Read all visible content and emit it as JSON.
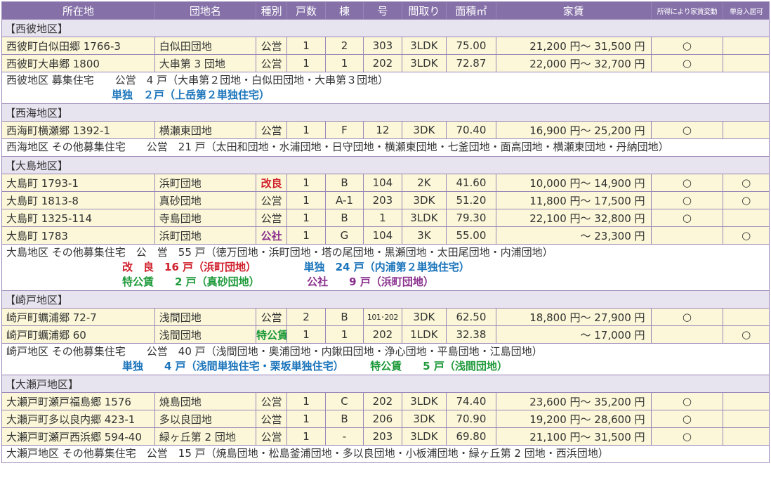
{
  "headers": [
    "所在地",
    "団地名",
    "種別",
    "戸数",
    "棟",
    "号",
    "間取り",
    "面積㎡",
    "家賃",
    "所得により家賃変動",
    "単身入居可"
  ],
  "sections": [
    {
      "title": "【西彼地区】",
      "rows": [
        {
          "addr": "西彼町白似田郷 1766-3",
          "name": "白似田団地",
          "type": "公営",
          "typeClass": "",
          "count": "1",
          "bldg": "2",
          "num": "303",
          "layout": "3LDK",
          "area": "75.00",
          "rent": "21,200 円〜 31,500 円",
          "income": "○",
          "single": ""
        },
        {
          "addr": "西彼町大串郷 1800",
          "name": "大串第 3 団地",
          "type": "公営",
          "typeClass": "",
          "count": "1",
          "bldg": "1",
          "num": "202",
          "layout": "3LDK",
          "area": "72.87",
          "rent": "22,000 円〜 32,700 円",
          "income": "○",
          "single": ""
        }
      ],
      "summary": [
        [
          {
            "t": "西彼地区 募集住宅　　公営　4 戸（大串第２団地・白似田団地・大串第３団地）",
            "c": "black"
          }
        ],
        [
          {
            "t": "　　　　　　　　　　単独　２戸（上岳第２単独住宅）",
            "c": "blue"
          }
        ]
      ]
    },
    {
      "title": "【西海地区】",
      "rows": [
        {
          "addr": "西海町横瀬郷 1392-1",
          "name": "横瀬東団地",
          "type": "公営",
          "typeClass": "",
          "count": "1",
          "bldg": "F",
          "num": "12",
          "layout": "3DK",
          "area": "70.40",
          "rent": "16,900 円〜 25,200 円",
          "income": "○",
          "single": ""
        }
      ],
      "summary": [
        [
          {
            "t": "西海地区 その他募集住宅　　公営　21 戸（太田和団地・水浦団地・日守団地・横瀬東団地・七釜団地・面高団地・横瀬東団地・丹納団地）",
            "c": "black"
          }
        ]
      ]
    },
    {
      "title": "【大島地区】",
      "rows": [
        {
          "addr": "大島町 1793-1",
          "name": "浜町団地",
          "type": "改良",
          "typeClass": "tag-red",
          "count": "1",
          "bldg": "B",
          "num": "104",
          "layout": "2K",
          "area": "41.60",
          "rent": "10,000 円〜 14,900 円",
          "income": "○",
          "single": "○"
        },
        {
          "addr": "大島町 1813-8",
          "name": "真砂団地",
          "type": "公営",
          "typeClass": "",
          "count": "1",
          "bldg": "A-1",
          "num": "203",
          "layout": "3DK",
          "area": "51.20",
          "rent": "11,800 円〜 17,500 円",
          "income": "○",
          "single": "○"
        },
        {
          "addr": "大島町 1325-114",
          "name": "寺島団地",
          "type": "公営",
          "typeClass": "",
          "count": "1",
          "bldg": "B",
          "num": "1",
          "layout": "3LDK",
          "area": "79.30",
          "rent": "22,100 円〜 32,800 円",
          "income": "○",
          "single": ""
        },
        {
          "addr": "大島町 1783",
          "name": "浜町団地",
          "type": "公社",
          "typeClass": "tag-purple",
          "count": "1",
          "bldg": "G",
          "num": "104",
          "layout": "3K",
          "area": "55.00",
          "rent": "〜 23,300 円",
          "income": "",
          "single": "○"
        }
      ],
      "summary": [
        [
          {
            "t": "大島地区 その他募集住宅　公　営　55 戸（徳万団地・浜町団地・塔の尾団地・黒瀬団地・太田尾団地・内浦団地）",
            "c": "black"
          }
        ],
        [
          {
            "t": "　　　　　　　　　　　改　良　16 戸（浜町団地）　　　",
            "c": "red"
          },
          {
            "t": "　　単独　24 戸（内浦第２単独住宅）",
            "c": "blue"
          }
        ],
        [
          {
            "t": "　　　　　　　　　　　特公賃　　2 戸（真砂団地）　　　",
            "c": "green"
          },
          {
            "t": "　　公社　　9 戸（浜町団地）",
            "c": "purple"
          }
        ]
      ]
    },
    {
      "title": "【崎戸地区】",
      "rows": [
        {
          "addr": "崎戸町蠣浦郷 72-7",
          "name": "浅間団地",
          "type": "公営",
          "typeClass": "",
          "count": "2",
          "bldg": "B",
          "num": "101･202",
          "layout": "3DK",
          "area": "62.50",
          "rent": "18,800 円〜 27,900 円",
          "income": "○",
          "single": "",
          "numSmall": true
        },
        {
          "addr": "崎戸町蠣浦郷 60",
          "name": "浅間団地",
          "type": "特公賃",
          "typeClass": "tag-green",
          "count": "1",
          "bldg": "1",
          "num": "202",
          "layout": "1LDK",
          "area": "32.38",
          "rent": "〜 17,000 円",
          "income": "",
          "single": "○"
        }
      ],
      "summary": [
        [
          {
            "t": "崎戸地区 その他募集住宅　　公営　40 戸（浅間団地・奥浦団地・内鍬田団地・浄心団地・平島団地・江島団地）",
            "c": "black"
          }
        ],
        [
          {
            "t": "　　　　　　　　　　　単独　　4 戸（浅間単独住宅・栗坂単独住宅）　　　",
            "c": "blue"
          },
          {
            "t": "特公賃　　5 戸（浅間団地）",
            "c": "green"
          }
        ]
      ]
    },
    {
      "title": "【大瀬戸地区】",
      "rows": [
        {
          "addr": "大瀬戸町瀬戸福島郷 1576",
          "name": "焼島団地",
          "type": "公営",
          "typeClass": "",
          "count": "1",
          "bldg": "C",
          "num": "202",
          "layout": "3LDK",
          "area": "74.40",
          "rent": "23,600 円〜 35,200 円",
          "income": "○",
          "single": ""
        },
        {
          "addr": "大瀬戸町多以良内郷 423-1",
          "name": "多以良団地",
          "type": "公営",
          "typeClass": "",
          "count": "1",
          "bldg": "B",
          "num": "206",
          "layout": "3DK",
          "area": "70.90",
          "rent": "19,200 円〜 28,600 円",
          "income": "○",
          "single": ""
        },
        {
          "addr": "大瀬戸町瀬戸西浜郷 594-40",
          "name": "緑ヶ丘第 2 団地",
          "type": "公営",
          "typeClass": "",
          "count": "1",
          "bldg": "-",
          "num": "203",
          "layout": "3LDK",
          "area": "69.80",
          "rent": "21,100 円〜 31,500 円",
          "income": "○",
          "single": ""
        }
      ],
      "summary": [
        [
          {
            "t": "大瀬戸地区 その他募集住宅　公営　15 戸（焼島団地・松島釜浦団地・多以良団地・小板浦団地・緑ヶ丘第 2 団地・西浜団地）",
            "c": "black"
          }
        ]
      ]
    }
  ]
}
